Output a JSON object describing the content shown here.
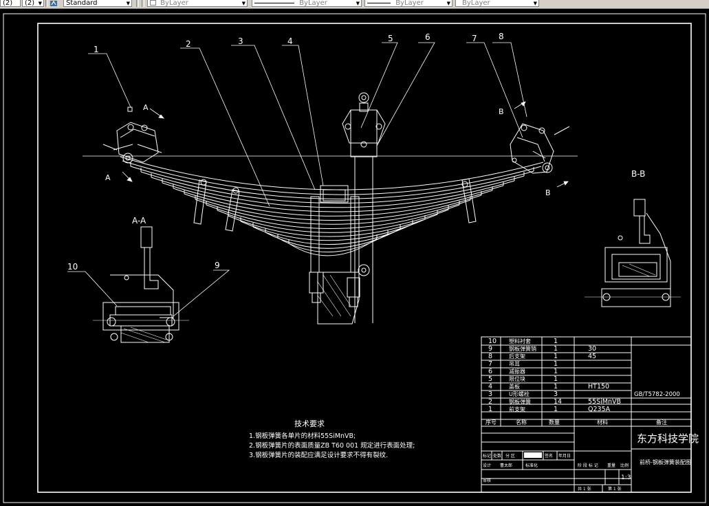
{
  "toolbar": {
    "field1_value": "(2)",
    "field2_value": "(2)",
    "textstyle_value": "Standard",
    "layer_value": "ByLayer",
    "linetype_value": "ByLayer",
    "lineweight_value": "ByLayer",
    "plotstyle_value": "ByLayer"
  },
  "colors": {
    "background": "#000000",
    "lines": "#ffffff",
    "toolbar": "#d4d0c8"
  },
  "drawing": {
    "balloons": [
      "1",
      "2",
      "3",
      "4",
      "5",
      "6",
      "7",
      "8",
      "9",
      "10"
    ],
    "section_marks": {
      "a": "A",
      "b": "B"
    },
    "section_aa_title": "A-A",
    "section_bb_title": "B-B",
    "tech_req": {
      "title": "技术要求",
      "items": [
        "1.钢板弹簧各单片的材料55SiMnVB;",
        "2.钢板弹簧片的表面质量ZB  T60  001  规定进行表面处理;",
        "3.钢板弹簧片的装配应满足设计要求不得有裂纹."
      ]
    }
  },
  "title_block": {
    "parts": [
      {
        "no": "10",
        "name": "塑料衬套",
        "qty": "1",
        "material": "",
        "note": ""
      },
      {
        "no": "9",
        "name": "钢板弹簧销",
        "qty": "1",
        "material": "30",
        "note": ""
      },
      {
        "no": "8",
        "name": "后支架",
        "qty": "1",
        "material": "45",
        "note": ""
      },
      {
        "no": "7",
        "name": "吊耳",
        "qty": "1",
        "material": "",
        "note": ""
      },
      {
        "no": "6",
        "name": "减振器",
        "qty": "1",
        "material": "",
        "note": ""
      },
      {
        "no": "5",
        "name": "限位块",
        "qty": "1",
        "material": "",
        "note": ""
      },
      {
        "no": "4",
        "name": "盖板",
        "qty": "1",
        "material": "HT150",
        "note": ""
      },
      {
        "no": "3",
        "name": "U形螺栓",
        "qty": "3",
        "material": "",
        "note": "GB/T5782-2000"
      },
      {
        "no": "2",
        "name": "钢板弹簧",
        "qty": "14",
        "material": "55SiMnVB",
        "note": ""
      },
      {
        "no": "1",
        "name": "前支架",
        "qty": "1",
        "material": "Q235A",
        "note": ""
      }
    ],
    "headers": {
      "no": "序号",
      "name": "名称",
      "qty": "数量",
      "material": "材料",
      "note": "备注"
    },
    "school": "东方科技学院",
    "drawing_title": "前桥-钢板弹簧装配图",
    "scale": "1:3",
    "labels": {
      "mark": "标记",
      "count": "处数",
      "zone": "分 区",
      "change_no": "更改文件号",
      "sign": "签名",
      "date": "年月日",
      "design": "设计",
      "designer": "曹太郎",
      "standard": "标准化",
      "stage": "阶 段 标 记",
      "weight": "重量",
      "ratio": "比例",
      "review": "审核",
      "process": "工艺",
      "approve": "批准",
      "sheets_total": "共 1 张",
      "sheet_no": "第 1 张"
    }
  }
}
